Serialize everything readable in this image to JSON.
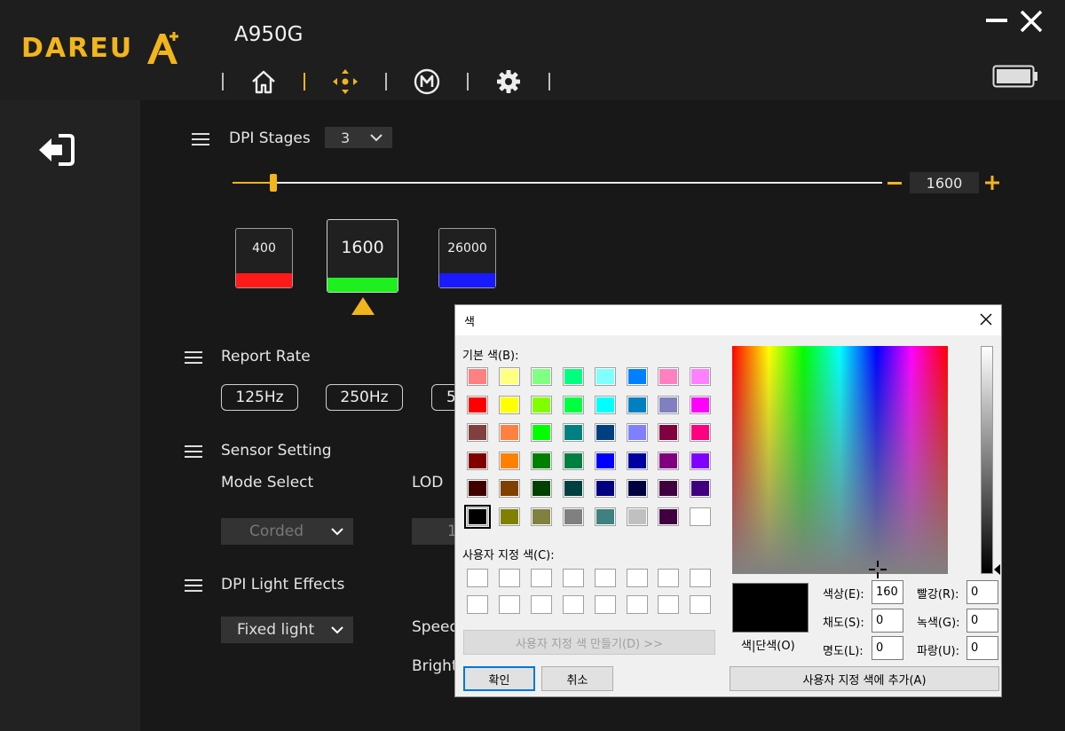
{
  "header": {
    "logo_text": "DAREU",
    "device_title": "A950G",
    "nav": [
      {
        "icon": "home-icon"
      },
      {
        "icon": "dpi-target-icon"
      },
      {
        "icon": "macro-m-icon"
      },
      {
        "icon": "gear-icon"
      }
    ],
    "accent": "#f2b51c"
  },
  "dpi": {
    "stages_label": "DPI Stages",
    "stages_value": "3",
    "slider_value": "1600",
    "slider_fraction": 0.06,
    "cards": [
      {
        "value": "400",
        "color": "#ff1a1a"
      },
      {
        "value": "1600",
        "color": "#1fef1f",
        "selected": true
      },
      {
        "value": "26000",
        "color": "#1a1aff"
      }
    ]
  },
  "report_rate": {
    "label": "Report Rate",
    "options": [
      "125Hz",
      "250Hz",
      "5"
    ]
  },
  "sensor": {
    "label": "Sensor Setting",
    "mode_label": "Mode Select",
    "mode_value": "Corded",
    "lod_label": "LOD",
    "lod_value": "1"
  },
  "light": {
    "label": "DPI Light Effects",
    "effect_value": "Fixed light",
    "speed_label": "Speed",
    "bright_label": "Bright"
  },
  "color_dialog": {
    "title": "색",
    "basic_label": "기본 색(B):",
    "custom_label": "사용자 지정 색(C):",
    "define_button": "사용자 지정 색 만들기(D) >>",
    "ok_button": "확인",
    "cancel_button": "취소",
    "solid_label": "색|단색(O)",
    "add_button": "사용자 지정 색에 추가(A)",
    "fields": {
      "hue_label": "색상(E):",
      "hue": "160",
      "sat_label": "채도(S):",
      "sat": "0",
      "lum_label": "명도(L):",
      "lum": "0",
      "red_label": "빨강(R):",
      "red": "0",
      "green_label": "녹색(G):",
      "green": "0",
      "blue_label": "파랑(U):",
      "blue": "0"
    },
    "basic_colors": [
      "#ff8080",
      "#ffff80",
      "#80ff80",
      "#00ff80",
      "#80ffff",
      "#0080ff",
      "#ff80c0",
      "#ff80ff",
      "#ff0000",
      "#ffff00",
      "#80ff00",
      "#00ff40",
      "#00ffff",
      "#0080c0",
      "#8080c0",
      "#ff00ff",
      "#804040",
      "#ff8040",
      "#00ff00",
      "#008080",
      "#004080",
      "#8080ff",
      "#800040",
      "#ff0080",
      "#800000",
      "#ff8000",
      "#008000",
      "#008040",
      "#0000ff",
      "#0000a0",
      "#800080",
      "#8000ff",
      "#400000",
      "#804000",
      "#004000",
      "#004040",
      "#000080",
      "#000040",
      "#400040",
      "#400080",
      "#000000",
      "#808000",
      "#808040",
      "#808080",
      "#408080",
      "#c0c0c0",
      "#400040",
      "#ffffff"
    ],
    "selected_index": 40
  }
}
